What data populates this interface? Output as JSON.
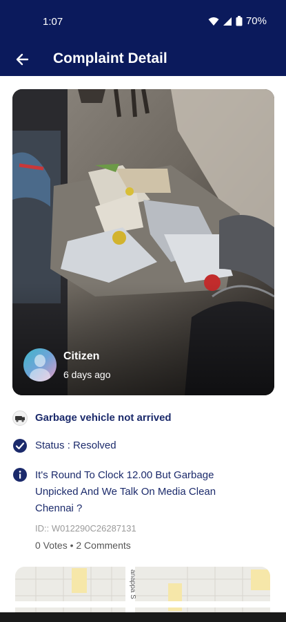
{
  "status_bar": {
    "time": "1:07",
    "battery": "70%"
  },
  "app_bar": {
    "title": "Complaint Detail"
  },
  "complaint": {
    "author": "Citizen",
    "posted": "6 days ago",
    "category": "Garbage vehicle not arrived",
    "status": "Status : Resolved",
    "description": "It's Round To Clock 12.00 But Garbage Unpicked And We Talk On Media Clean Chennai ?",
    "id": "ID:: W012290C26287131",
    "engagement": "0 Votes • 2 Comments"
  },
  "map": {
    "street_label": "anappa S"
  },
  "colors": {
    "primary": "#0b1a5c",
    "accent_text": "#1b2a6b",
    "muted": "#9a9a9a"
  },
  "icons": [
    "back-arrow-icon",
    "wifi-icon",
    "signal-icon",
    "battery-icon",
    "category-icon",
    "check-circle-icon",
    "info-icon",
    "map-pin-icon"
  ]
}
